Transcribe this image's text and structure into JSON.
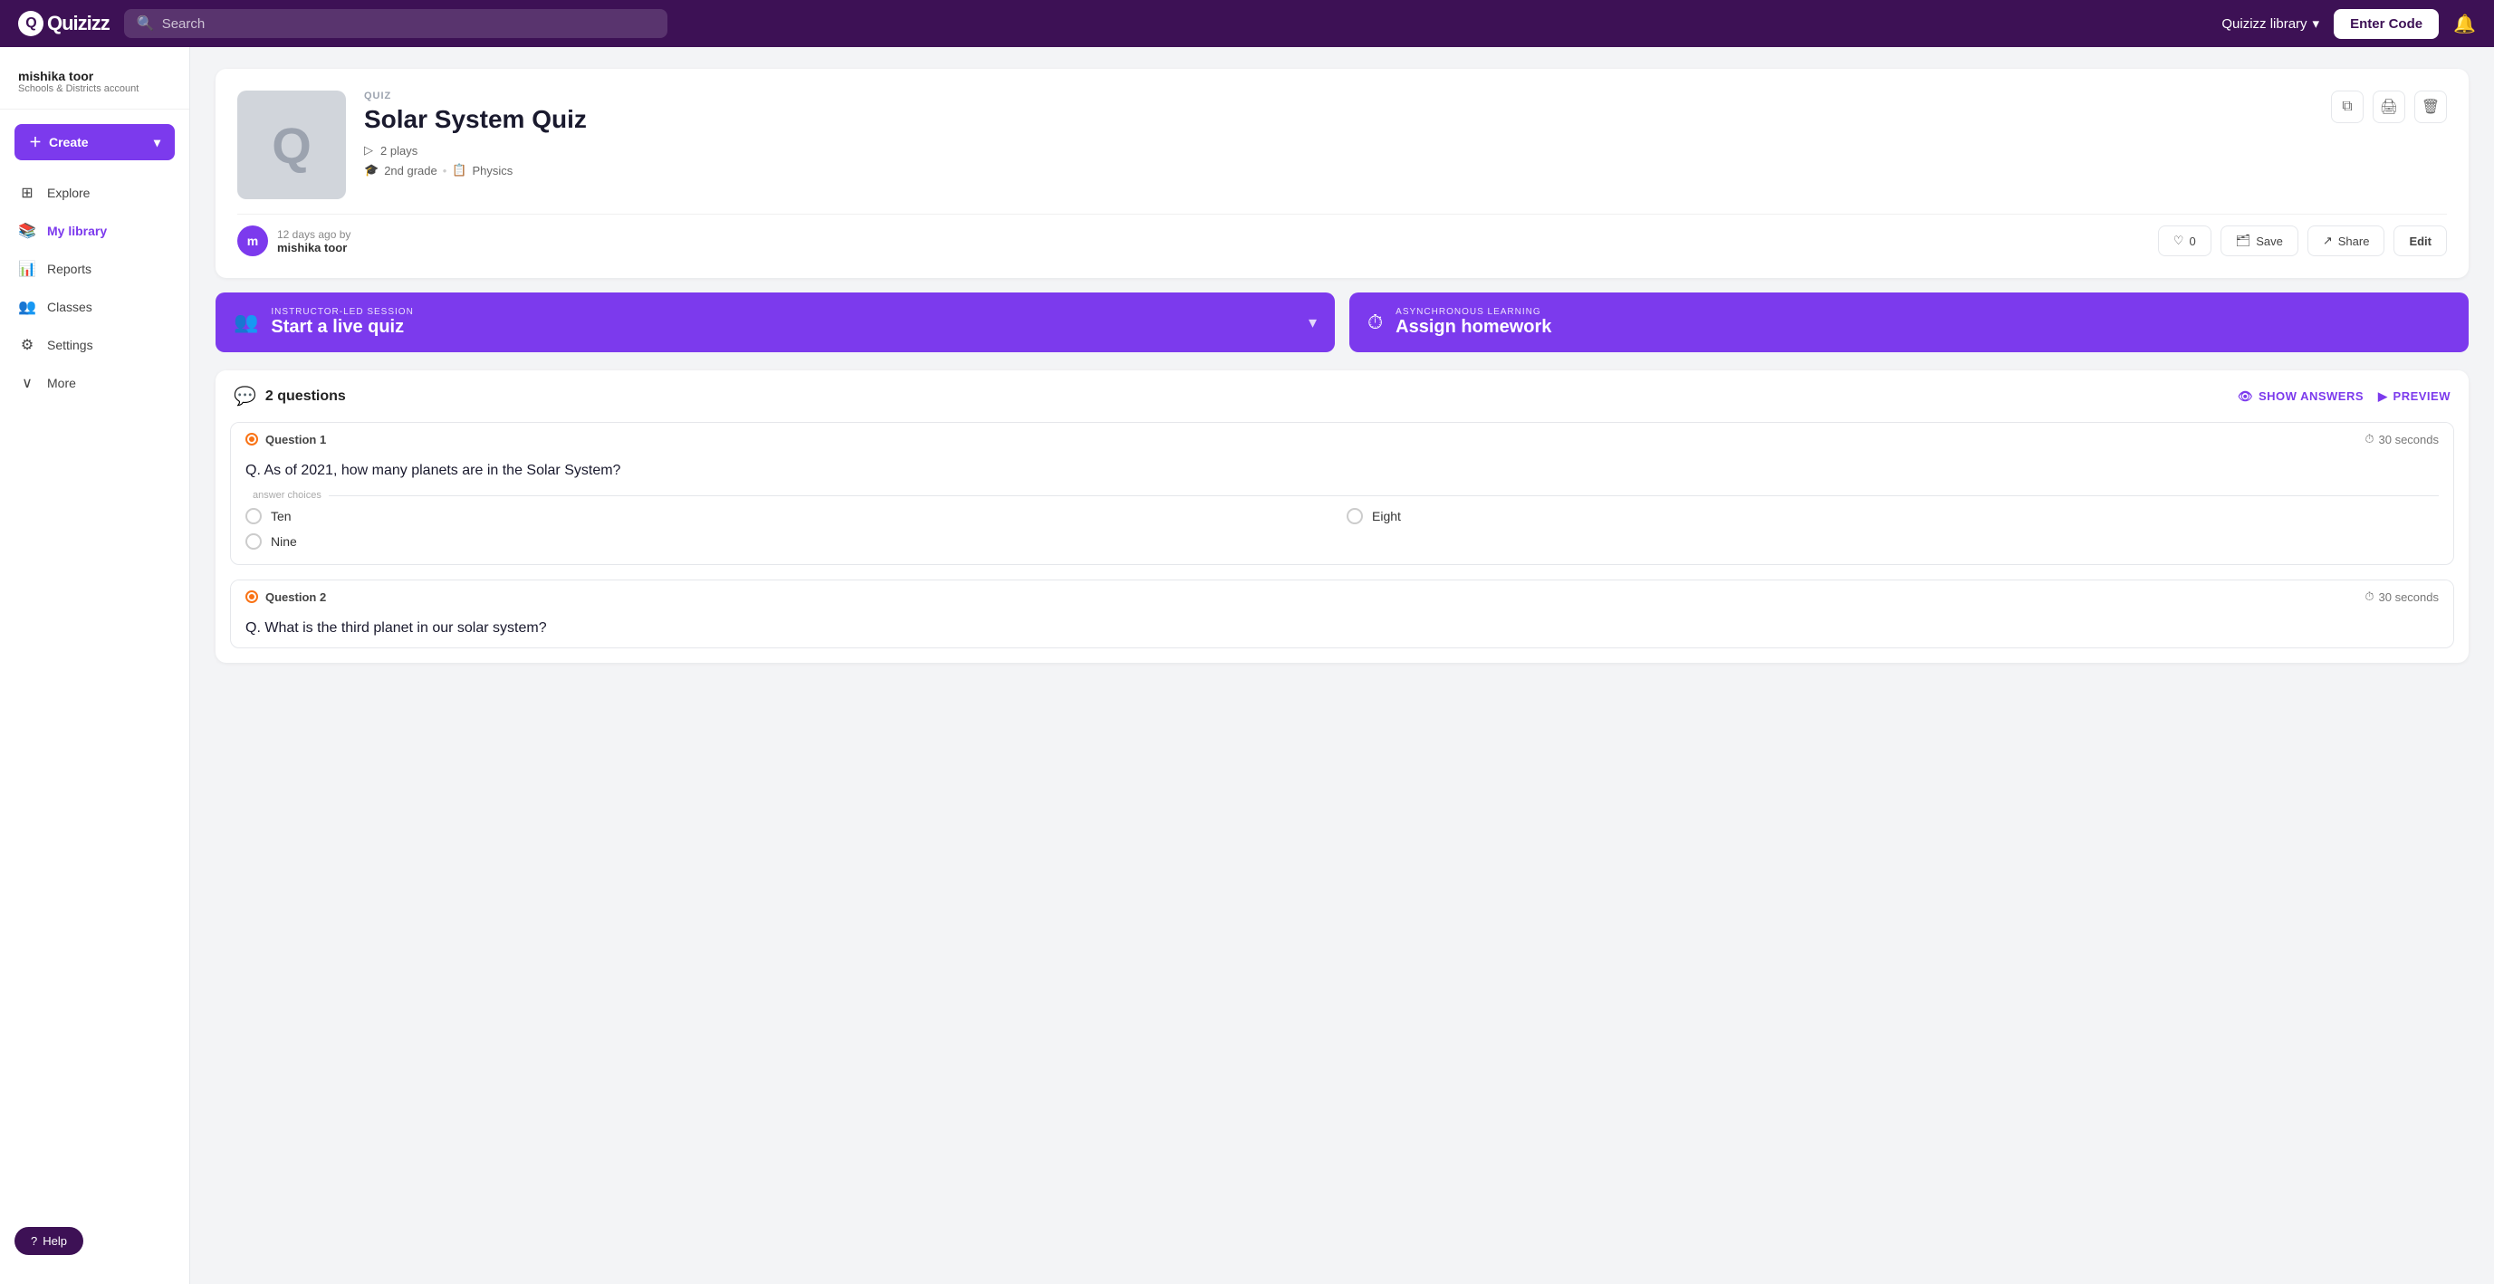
{
  "topnav": {
    "logo_text": "Quizizz",
    "search_placeholder": "Search",
    "library_label": "Quizizz library",
    "enter_code_label": "Enter Code"
  },
  "sidebar": {
    "user_name": "mishika toor",
    "user_sub": "Schools & Districts account",
    "create_label": "Create",
    "nav_items": [
      {
        "id": "explore",
        "label": "Explore",
        "icon": "⊞"
      },
      {
        "id": "my-library",
        "label": "My library",
        "icon": "📚",
        "active": true
      },
      {
        "id": "reports",
        "label": "Reports",
        "icon": "📊"
      },
      {
        "id": "classes",
        "label": "Classes",
        "icon": "👥"
      },
      {
        "id": "settings",
        "label": "Settings",
        "icon": "⚙"
      },
      {
        "id": "more",
        "label": "More",
        "icon": "∨"
      }
    ],
    "help_label": "Help"
  },
  "quiz": {
    "badge_label": "QUIZ",
    "title": "Solar System Quiz",
    "plays": "2 plays",
    "grade": "2nd grade",
    "subject": "Physics",
    "author_initial": "m",
    "author_days_ago": "12 days ago by",
    "author_name": "mishika toor",
    "save_label": "Save",
    "share_label": "Share",
    "edit_label": "Edit",
    "likes_count": "0"
  },
  "sessions": {
    "live_label": "INSTRUCTOR-LED SESSION",
    "live_title": "Start a live quiz",
    "homework_label": "ASYNCHRONOUS LEARNING",
    "homework_title": "Assign homework"
  },
  "questions": {
    "header_icon": "💬",
    "count_label": "2 questions",
    "show_answers_label": "SHOW ANSWERS",
    "preview_label": "PREVIEW",
    "items": [
      {
        "num": "Question 1",
        "time": "30 seconds",
        "text": "Q. As of 2021, how many planets are in the Solar System?",
        "choices_label": "answer choices",
        "choices": [
          "Ten",
          "Eight",
          "Nine"
        ]
      },
      {
        "num": "Question 2",
        "time": "30 seconds",
        "text": "Q. What is the third planet in our solar system?"
      }
    ]
  }
}
